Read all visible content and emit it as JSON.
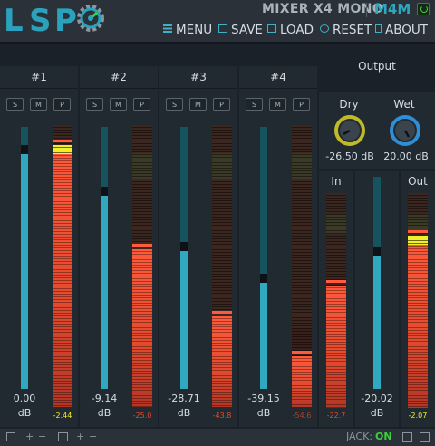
{
  "header": {
    "logo": [
      "L",
      "S",
      "P"
    ],
    "title": "MIXER X4 MONO",
    "variant": "M4M"
  },
  "menu": [
    {
      "label": "MENU",
      "icon": "menu-icon"
    },
    {
      "label": "SAVE",
      "icon": "save-icon"
    },
    {
      "label": "LOAD",
      "icon": "load-icon"
    },
    {
      "label": "RESET",
      "icon": "reset-icon"
    },
    {
      "label": "ABOUT",
      "icon": "about-icon"
    }
  ],
  "channels": [
    {
      "name": "#1",
      "buttons": [
        "S",
        "M",
        "P"
      ],
      "gain_text": "0.00",
      "unit": "dB",
      "peak": "-2.44",
      "fader_level": 0.93,
      "meter_level": 0.93
    },
    {
      "name": "#2",
      "buttons": [
        "S",
        "M",
        "P"
      ],
      "gain_text": "-9.14",
      "unit": "dB",
      "peak": "-25.0",
      "fader_level": 0.77,
      "meter_level": 0.56
    },
    {
      "name": "#3",
      "buttons": [
        "S",
        "M",
        "P"
      ],
      "gain_text": "-28.71",
      "unit": "dB",
      "peak": "-43.8",
      "fader_level": 0.56,
      "meter_level": 0.32
    },
    {
      "name": "#4",
      "buttons": [
        "S",
        "M",
        "P"
      ],
      "gain_text": "-39.15",
      "unit": "dB",
      "peak": "-54.6",
      "fader_level": 0.44,
      "meter_level": 0.18
    }
  ],
  "output": {
    "title": "Output",
    "dry": {
      "label": "Dry",
      "value": "-26.50 dB"
    },
    "wet": {
      "label": "Wet",
      "value": "20.00 dB"
    },
    "in_label": "In",
    "out_label": "Out",
    "in_peak": "-22.7",
    "out_gain": "-20.02",
    "out_unit": "dB",
    "out_peak": "-2.07",
    "in_level": 0.57,
    "out_fader_level": 0.67,
    "out_level": 0.8
  },
  "footer": {
    "jack_label": "JACK:",
    "jack_status": "ON",
    "plus": "+",
    "minus": "−"
  },
  "colors": {
    "accent": "#2aa2bd",
    "meter_red": "#e34a2e",
    "peak_yellow": "#f1ef2a",
    "jack_on": "#3bd33b"
  }
}
